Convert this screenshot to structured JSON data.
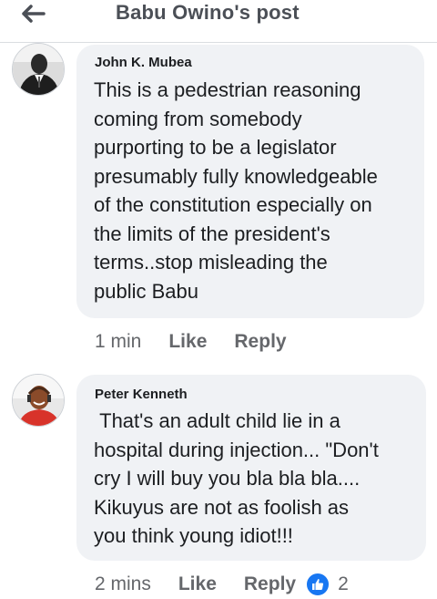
{
  "header": {
    "back_icon": "arrow-left-icon",
    "title": "Babu Owino's post"
  },
  "comments": [
    {
      "author": "John K. Mubea",
      "lines": [
        "This is a pedestrian reasoning",
        "coming from somebody",
        "purporting to be a legislator",
        "presumably fully knowledgeable",
        "of the constitution especially on",
        "the limits of the president's",
        "terms..stop misleading the",
        "public Babu"
      ],
      "time": "1 min",
      "like_label": "Like",
      "reply_label": "Reply"
    },
    {
      "author": "Peter Kenneth",
      "lines": [
        " That's an adult child lie in a",
        "hospital during injection... \"Don't",
        "cry I will buy you bla bla bla....",
        "Kikuyus are not as foolish as",
        "you think young idiot!!!"
      ],
      "time": "2 mins",
      "like_label": "Like",
      "reply_label": "Reply",
      "reaction_icon": "thumbs-up-icon",
      "reaction_count": "2"
    }
  ],
  "colors": {
    "bubble": "#f0f2f5",
    "meta_text": "#65676b",
    "like_reaction": "#1877f2"
  }
}
